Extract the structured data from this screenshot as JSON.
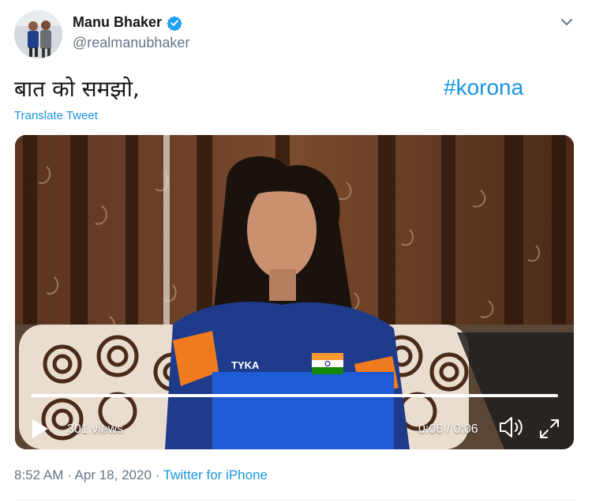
{
  "author": {
    "name": "Manu Bhaker",
    "handle": "@realmanubhaker",
    "verified": true
  },
  "tweet": {
    "text": "बात को समझो,",
    "hashtag": "#korona",
    "translate_label": "Translate Tweet"
  },
  "video": {
    "views": "301 views",
    "time": "0:06 / 0:06",
    "progress": 1.0,
    "jersey_text": "TYKA"
  },
  "meta": {
    "time": "8:52 AM",
    "separator": " · ",
    "date": "Apr 18, 2020",
    "source": "Twitter for iPhone"
  },
  "colors": {
    "link": "#1b95e0",
    "secondary_text": "#657786",
    "verified": "#1da1f2"
  },
  "icons": [
    "verified-badge-icon",
    "chevron-down-icon",
    "play-icon",
    "volume-icon",
    "fullscreen-icon"
  ]
}
